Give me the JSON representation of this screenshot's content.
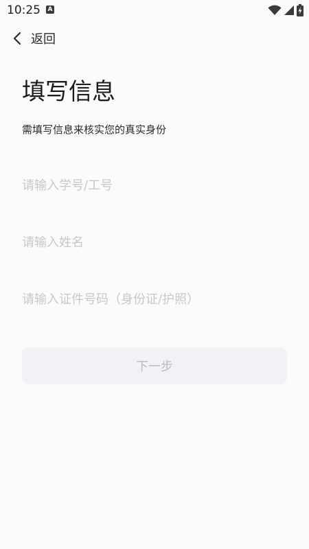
{
  "status_bar": {
    "time": "10:25",
    "app_icon_letter": "A",
    "icons": [
      "wifi-icon",
      "signal-icon",
      "battery-charging-icon"
    ]
  },
  "nav": {
    "back_label": "返回"
  },
  "page": {
    "title": "填写信息",
    "subtitle": "需填写信息来核实您的真实身份"
  },
  "form": {
    "student_id_placeholder": "请输入学号/工号",
    "name_placeholder": "请输入姓名",
    "id_number_placeholder": "请输入证件号码（身份证/护照）",
    "student_id_value": "",
    "name_value": "",
    "id_number_value": ""
  },
  "actions": {
    "next_label": "下一步"
  },
  "colors": {
    "background": "#fbfbfb",
    "placeholder": "#c4c7cd",
    "button_bg": "#f1f2f5",
    "button_text": "#b8bbc2"
  }
}
